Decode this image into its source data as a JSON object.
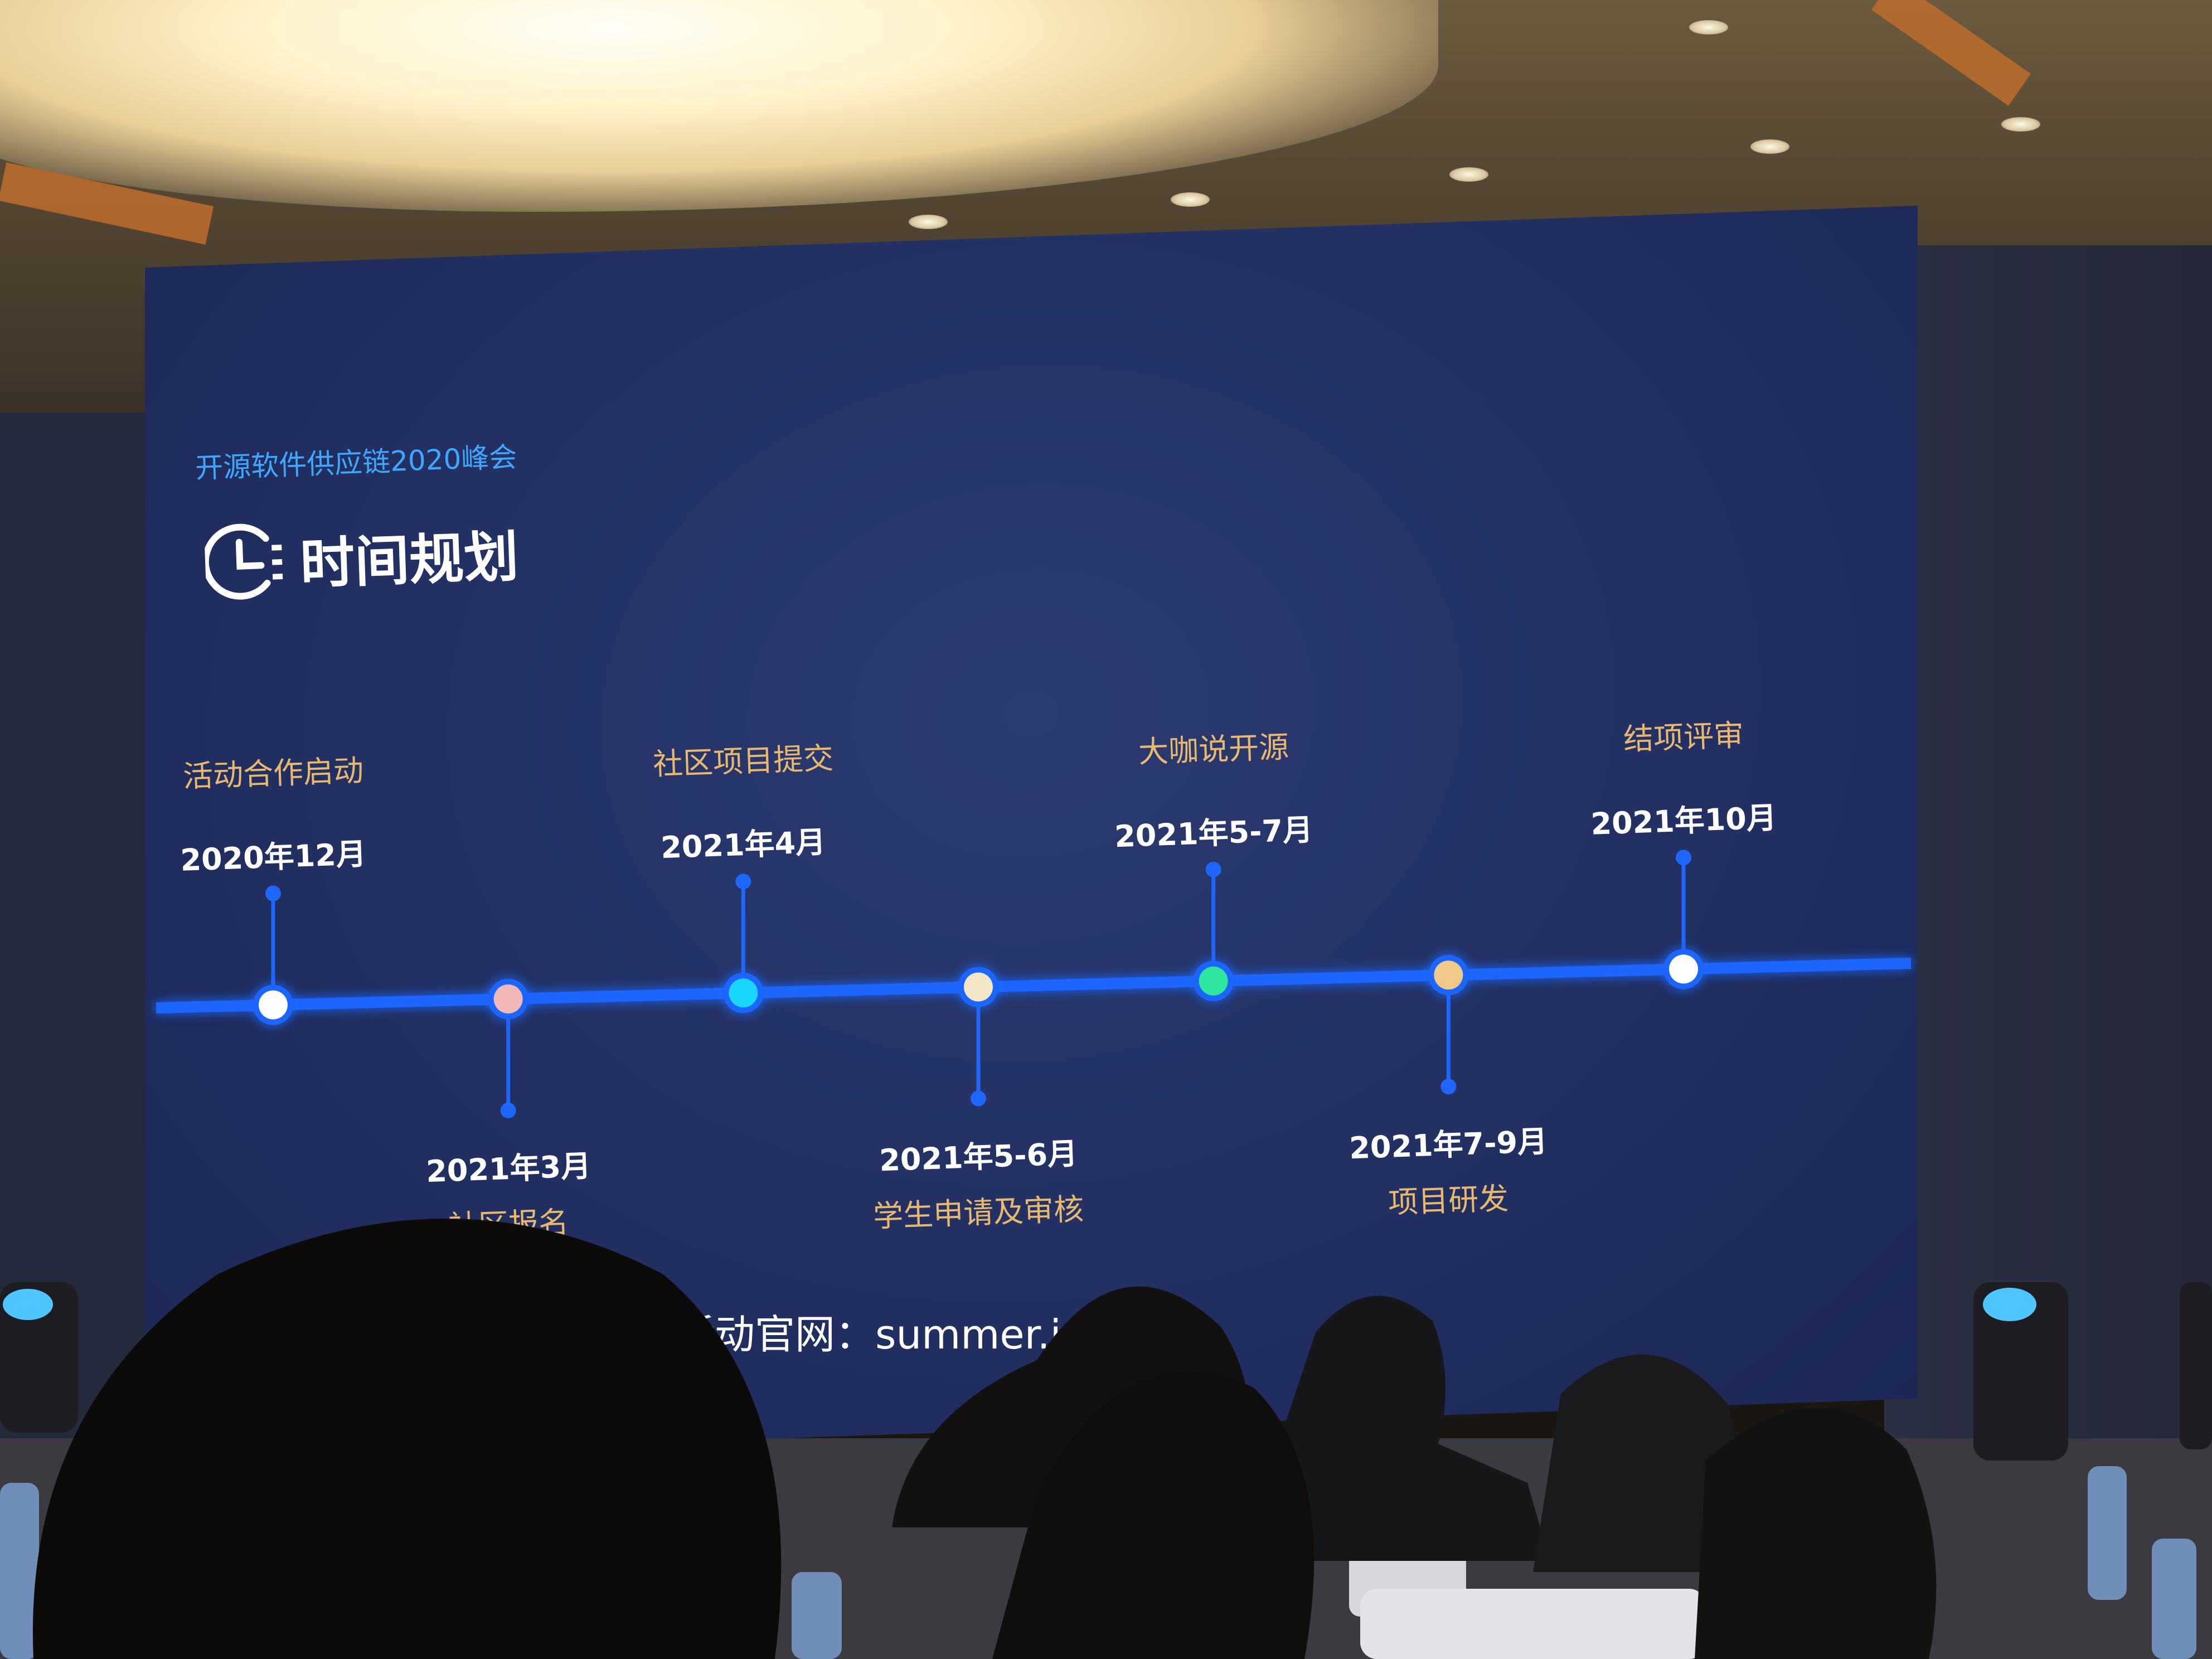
{
  "slide": {
    "conference": "开源软件供应链2020峰会",
    "title": "时间规划",
    "website": "活动官网：summer.is",
    "colors": {
      "background": "#223063",
      "timeline": "#1f66ff",
      "accent_text": "#3fa7ff",
      "event_text": "#e8b870"
    },
    "milestones": [
      {
        "date": "2020年12月",
        "event": "活动合作启动",
        "position": "above",
        "color": "#ffffff"
      },
      {
        "date": "2021年3月",
        "event": "社区报名",
        "position": "below",
        "color": "#f3b9b9"
      },
      {
        "date": "2021年4月",
        "event": "社区项目提交",
        "position": "above",
        "color": "#19d6ff"
      },
      {
        "date": "2021年5-6月",
        "event": "学生申请及审核",
        "position": "below",
        "color": "#f4e7c8"
      },
      {
        "date": "2021年5-7月",
        "event": "大咖说开源",
        "position": "above",
        "color": "#2fe6a0"
      },
      {
        "date": "2021年7-9月",
        "event": "项目研发",
        "position": "below",
        "color": "#f0c888"
      },
      {
        "date": "2021年10月",
        "event": "结项评审",
        "position": "above",
        "color": "#ffffff"
      }
    ]
  }
}
